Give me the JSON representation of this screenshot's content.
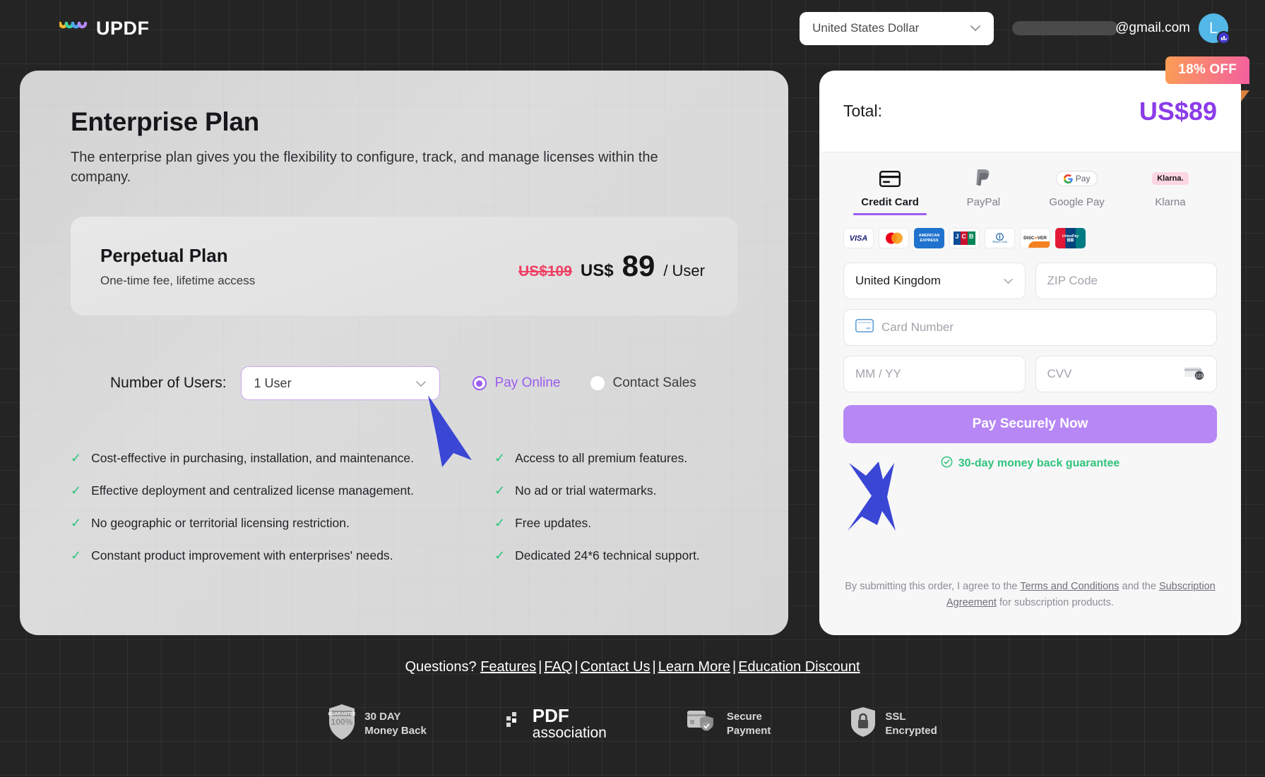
{
  "header": {
    "brand": "UPDF",
    "currency_selected": "United States Dollar",
    "email_domain": "@gmail.com",
    "avatar_initial": "L"
  },
  "plan": {
    "title": "Enterprise Plan",
    "description": "The enterprise plan gives you the flexibility to configure, track, and manage licenses within the company.",
    "perpetual": {
      "name": "Perpetual Plan",
      "desc": "One-time fee, lifetime access",
      "price_old": "US$109",
      "price_currency": "US$",
      "price_amount": "89",
      "price_unit": "/ User"
    },
    "users_label": "Number of Users:",
    "users_value": "1 User",
    "pay_options": [
      {
        "label": "Pay Online",
        "selected": true
      },
      {
        "label": "Contact Sales",
        "selected": false
      }
    ],
    "features_left": [
      "Cost-effective in purchasing, installation, and maintenance.",
      "Effective deployment and centralized license management.",
      "No geographic or territorial licensing restriction.",
      "Constant product improvement with enterprises' needs."
    ],
    "features_right": [
      "Access to all premium features.",
      "No ad or trial watermarks.",
      "Free updates.",
      "Dedicated 24*6 technical support."
    ]
  },
  "checkout": {
    "discount_badge": "18% OFF",
    "total_label": "Total:",
    "total_amount": "US$89",
    "methods": [
      {
        "label": "Credit Card",
        "icon": "credit-card-icon",
        "active": true
      },
      {
        "label": "PayPal",
        "icon": "paypal-icon",
        "active": false
      },
      {
        "label": "Google Pay",
        "icon": "google-pay-icon",
        "active": false
      },
      {
        "label": "Klarna",
        "icon": "klarna-icon",
        "active": false
      }
    ],
    "card_brands": [
      "VISA",
      "Mastercard",
      "American Express",
      "JCB",
      "Diners Club",
      "Discover",
      "UnionPay"
    ],
    "country_value": "United Kingdom",
    "zip_placeholder": "ZIP Code",
    "card_number_placeholder": "Card Number",
    "expiry_placeholder": "MM / YY",
    "cvv_placeholder": "CVV",
    "cvv_hint": "123",
    "pay_button": "Pay Securely Now",
    "guarantee": "30-day money back guarantee",
    "terms_prefix": "By submitting this order, I agree to the ",
    "terms_link_1": "Terms and Conditions",
    "terms_middle": " and the ",
    "terms_link_2": "Subscription Agreement",
    "terms_suffix": " for subscription products."
  },
  "footer": {
    "questions_label": "Questions?",
    "links": [
      "Features",
      "FAQ",
      "Contact Us",
      "Learn More",
      "Education Discount"
    ],
    "trust_badges": [
      {
        "icon": "guarantee-shield-icon",
        "line1": "30 DAY",
        "line2": "Money Back",
        "shield_top": "GUARANTEE",
        "shield_main": "100%"
      },
      {
        "icon": "pdf-association-icon",
        "line1": "PDF",
        "line2": "association"
      },
      {
        "icon": "secure-payment-icon",
        "line1": "Secure",
        "line2": "Payment"
      },
      {
        "icon": "ssl-lock-icon",
        "line1": "SSL",
        "line2": "Encrypted"
      }
    ]
  },
  "colors": {
    "accent_purple": "#9b5cf0",
    "total_purple": "#8b3ce8",
    "green": "#2fc47c",
    "strike_red": "#ef3e63",
    "cursor_blue": "#3a46d4"
  }
}
